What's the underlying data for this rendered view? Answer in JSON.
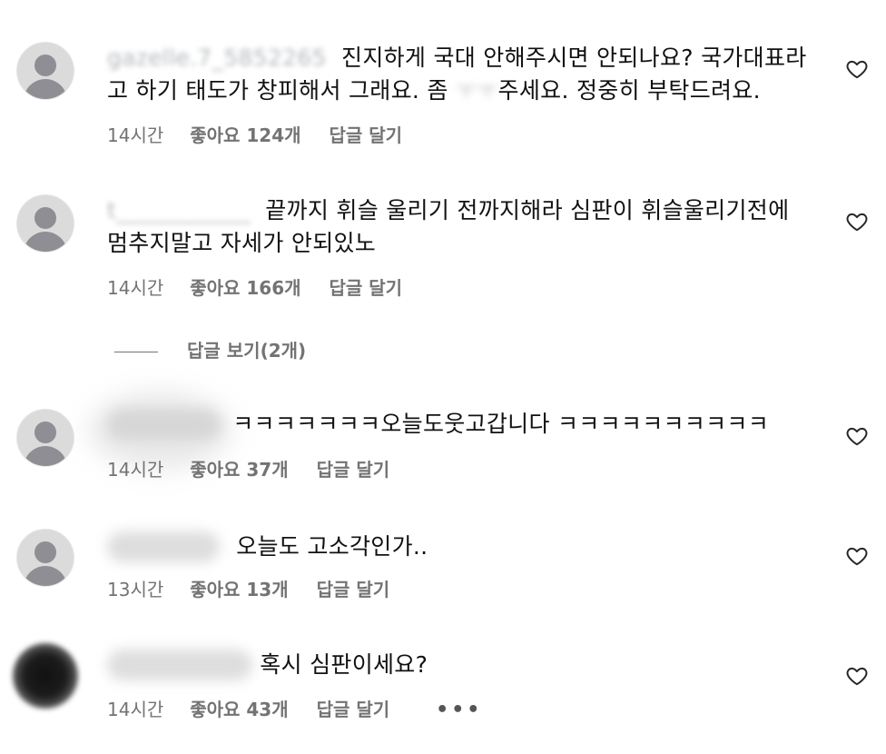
{
  "comments": [
    {
      "username": "gazelle.7_5852265",
      "lines": [
        "진지하게 국대 안해주시면 안되나요? 국가대표라",
        "고 하기 태도가 창피해서 그래요. 좀 ",
        "주세요. 정중히 부탁드려요."
      ],
      "masked": "ㅜㅜ",
      "time": "14시간",
      "likes": "좋아요 124개",
      "reply": "답글 달기"
    },
    {
      "username": "t_______________",
      "lines": [
        "끝까지 휘슬 울리기 전까지해라 심판이 휘슬울리기전에",
        "멈추지말고 자세가 안되있노"
      ],
      "time": "14시간",
      "likes": "좋아요 166개",
      "reply": "답글 달기"
    },
    {
      "username": "",
      "lines": [
        "ㅋㅋㅋㅋㅋㅋㅋ오늘도웃고갑니다 ㅋㅋㅋㅋㅋㅋㅋㅋㅋㅋ"
      ],
      "time": "14시간",
      "likes": "좋아요 37개",
      "reply": "답글 달기"
    },
    {
      "username": "",
      "lines": [
        "오늘도 고소각인가.."
      ],
      "time": "13시간",
      "likes": "좋아요 13개",
      "reply": "답글 달기"
    },
    {
      "username": "",
      "lines": [
        "혹시 심판이세요?"
      ],
      "time": "14시간",
      "likes": "좋아요 43개",
      "reply": "답글 달기",
      "more": "•••"
    }
  ],
  "view_replies": "답글 보기(2개)",
  "icons": {
    "heart": "heart-outline-icon",
    "avatar": "default-avatar-icon",
    "more": "more-horizontal-icon"
  },
  "colors": {
    "text": "#111111",
    "meta": "#737373",
    "avatar_bg": "#dbdbdb",
    "avatar_fg": "#8e8e94"
  }
}
